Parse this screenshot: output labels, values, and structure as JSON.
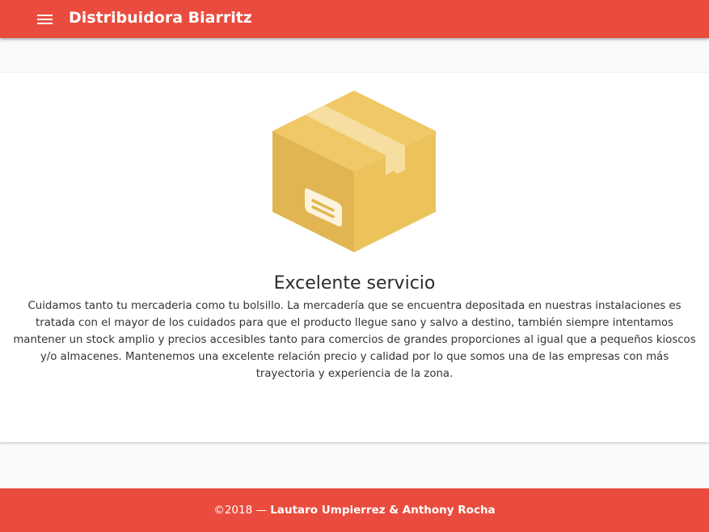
{
  "header": {
    "title": "Distribuidora Biarritz",
    "menu_icon": "menu-icon",
    "background_color": "#e94c3e"
  },
  "card": {
    "icon": "package-box-icon",
    "title": "Excelente servicio",
    "text": "Cuidamos tanto tu mercaderia como tu bolsillo. La mercadería que se encuentra depositada en nuestras instalaciones es tratada con el mayor de los cuidados para que el producto llegue sano y salvo a destino, también siempre intentamos mantener un stock amplio y precios accesibles tanto para comercios de grandes proporciones al igual que a pequeños kioscos y/o almacenes. Mantenemos una excelente relación precio y calidad por lo que somos una de las empresas con más trayectoria y experiencia de la zona."
  },
  "footer": {
    "copyright": "©2018 — ",
    "authors": "Lautaro Umpierrez & Anthony Rocha",
    "background_color": "#e94c3e"
  }
}
